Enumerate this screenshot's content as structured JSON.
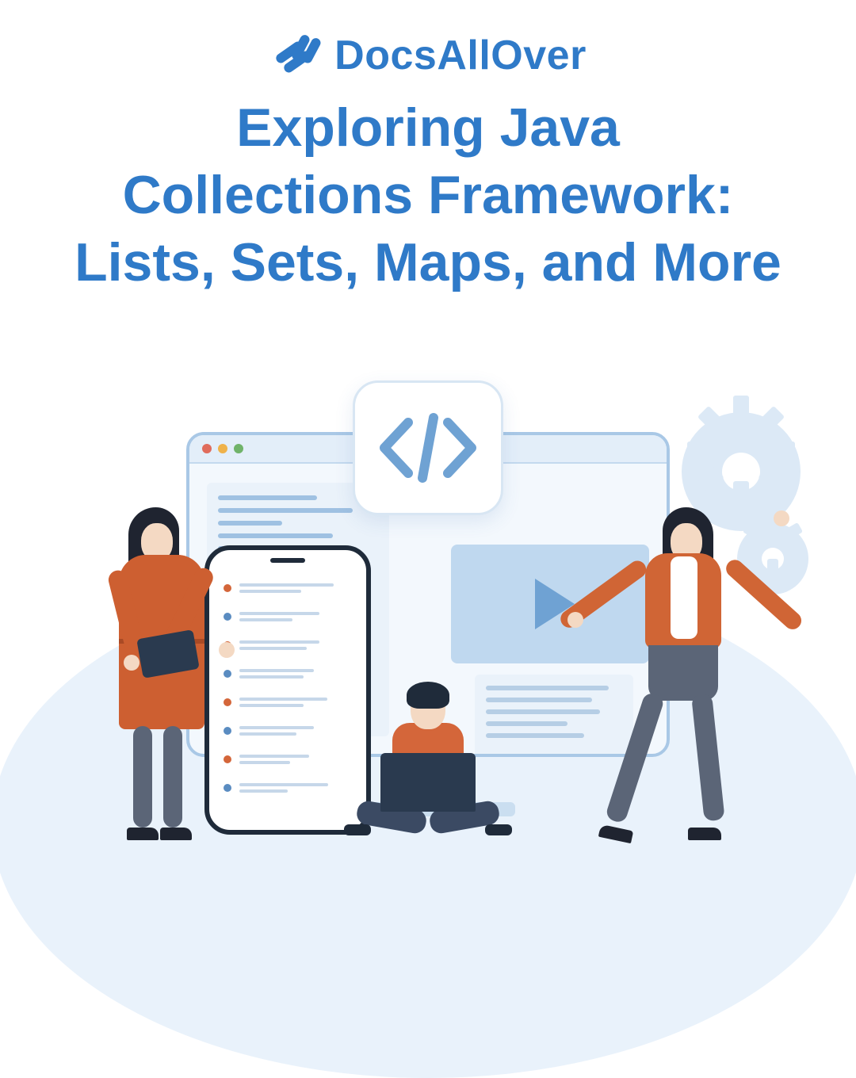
{
  "brand": {
    "name": "DocsAllOver"
  },
  "title": {
    "line1": "Exploring Java",
    "line2": "Collections Framework:",
    "line3": "Lists, Sets, Maps, and More"
  },
  "colors": {
    "primary": "#2f7ac8",
    "accent_orange": "#cd5f31",
    "pale_blue": "#e9f2fb",
    "mid_blue": "#a9c8e6",
    "dark_navy": "#1f2b3a",
    "grey_blue": "#5b6577"
  },
  "illustration": {
    "code_badge_symbol": "</>",
    "monitor": {
      "traffic_lights": [
        "red",
        "yellow",
        "green"
      ],
      "panels": [
        "code",
        "video",
        "document"
      ]
    },
    "phone": {
      "list_items": 8
    },
    "people": [
      "woman-left-holding-tablet",
      "person-sitting-with-laptop",
      "woman-right-arms-spread"
    ],
    "background_elements": [
      "gear-large",
      "gear-small",
      "ground-ellipse"
    ]
  }
}
